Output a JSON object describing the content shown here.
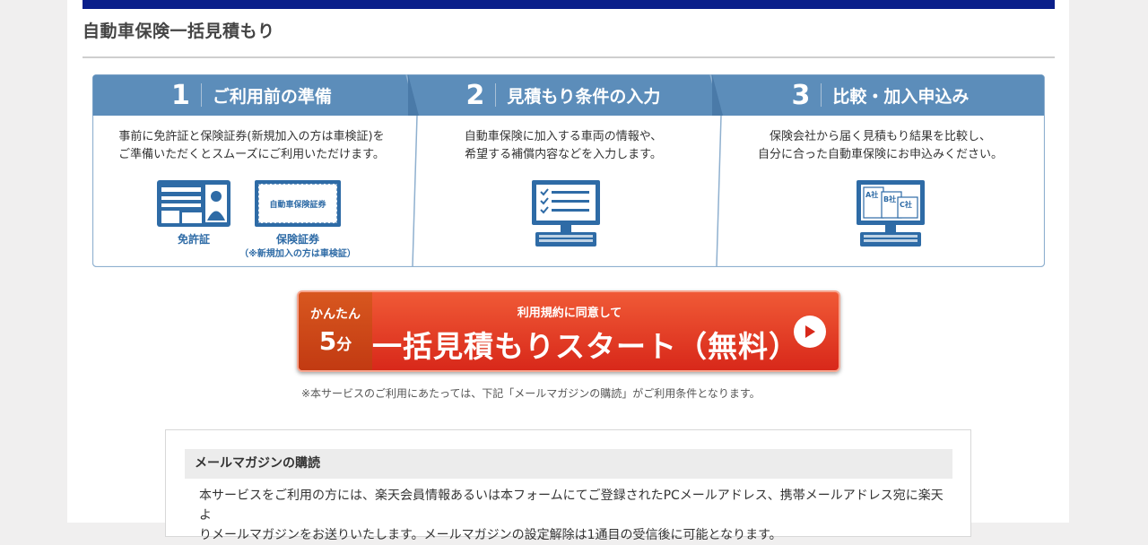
{
  "page": {
    "title": "自動車保険一括見積もり"
  },
  "steps": [
    {
      "number": "1",
      "title": "ご利用前の準備",
      "desc": [
        "事前に免許証と保険証券(新規加入の方は車検証)を",
        "ご準備いただくとスムーズにご利用いただけます。"
      ],
      "icon_labels": [
        "免許証",
        "保険証券"
      ],
      "icon_note": "（※新規加入の方は車検証）",
      "card_text": "自動車保険証券",
      "icons": [
        "license-card-icon",
        "insurance-certificate-icon"
      ]
    },
    {
      "number": "2",
      "title": "見積もり条件の入力",
      "desc": [
        "自動車保険に加入する車両の情報や、",
        "希望する補償内容などを入力します。"
      ],
      "icons": [
        "computer-checklist-icon"
      ]
    },
    {
      "number": "3",
      "title": "比較・加入申込み",
      "desc": [
        "保険会社から届く見積もり結果を比較し、",
        "自分に合った自動車保険にお申込みください。"
      ],
      "company_labels": [
        "A社",
        "B社",
        "C社"
      ],
      "icons": [
        "computer-compare-icon"
      ]
    }
  ],
  "start_button": {
    "easy_label": "かんたん",
    "minutes_num": "5",
    "minutes_unit": "分",
    "agree_label": "利用規約に同意して",
    "main_label": "一括見積もりスタート（無料）",
    "icon": "arrow-right-circle-icon"
  },
  "notice": "※本サービスのご利用にあたっては、下記「メールマガジンの購読」がご利用条件となります。",
  "mail": {
    "heading": "メールマガジンの購読",
    "lines": [
      "本サービスをご利用の方には、楽天会員情報あるいは本フォームにてご登録されたPCメールアドレス、携帯メールアドレス宛に楽天よ",
      "りメールマガジンをお送りいたします。メールマガジンの設定解除は1通目の受信後に可能となります。"
    ]
  },
  "colors": {
    "header_bar": "#0b1f8a",
    "step_header": "#5c8dba",
    "icon_blue": "#2e6ba6",
    "button_red": "#e03a22"
  }
}
